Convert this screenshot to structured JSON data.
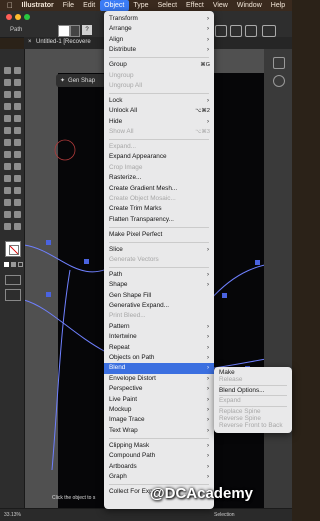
{
  "menubar": {
    "items": [
      "Illustrator",
      "File",
      "Edit",
      "Object",
      "Type",
      "Select",
      "Effect",
      "View",
      "Window",
      "Help"
    ],
    "active": "Object"
  },
  "control_bar": {
    "selection_label": "Path",
    "stroke_value": "?"
  },
  "document_tab": {
    "title": "Untitled-1 [Recovere"
  },
  "canvas_chip": {
    "label": "Gen Shap"
  },
  "status_bar": {
    "zoom": "33.13%",
    "hint": "Click the object to s",
    "mode": "Selection"
  },
  "object_menu": {
    "items": [
      {
        "label": "Transform",
        "submenu": true
      },
      {
        "label": "Arrange",
        "submenu": true
      },
      {
        "label": "Align",
        "submenu": true
      },
      {
        "label": "Distribute",
        "submenu": true
      },
      {
        "sep": true
      },
      {
        "label": "Group",
        "shortcut": "⌘G"
      },
      {
        "label": "Ungroup",
        "disabled": true
      },
      {
        "label": "Ungroup All",
        "disabled": true
      },
      {
        "sep": true
      },
      {
        "label": "Lock",
        "submenu": true
      },
      {
        "label": "Unlock All",
        "shortcut": "⌥⌘2"
      },
      {
        "label": "Hide",
        "submenu": true
      },
      {
        "label": "Show All",
        "shortcut": "⌥⌘3",
        "disabled": true
      },
      {
        "sep": true
      },
      {
        "label": "Expand...",
        "disabled": true
      },
      {
        "label": "Expand Appearance"
      },
      {
        "label": "Crop Image",
        "disabled": true
      },
      {
        "label": "Rasterize..."
      },
      {
        "label": "Create Gradient Mesh..."
      },
      {
        "label": "Create Object Mosaic...",
        "disabled": true
      },
      {
        "label": "Create Trim Marks"
      },
      {
        "label": "Flatten Transparency..."
      },
      {
        "sep": true
      },
      {
        "label": "Make Pixel Perfect"
      },
      {
        "sep": true
      },
      {
        "label": "Slice",
        "submenu": true
      },
      {
        "label": "Generate Vectors",
        "disabled": true
      },
      {
        "sep": true
      },
      {
        "label": "Path",
        "submenu": true
      },
      {
        "label": "Shape",
        "submenu": true
      },
      {
        "label": "Gen Shape Fill"
      },
      {
        "label": "Generative Expand..."
      },
      {
        "label": "Print Bleed...",
        "disabled": true
      },
      {
        "label": "Pattern",
        "submenu": true
      },
      {
        "label": "Intertwine",
        "submenu": true
      },
      {
        "label": "Repeat",
        "submenu": true
      },
      {
        "label": "Objects on Path",
        "submenu": true
      },
      {
        "label": "Blend",
        "submenu": true,
        "highlighted": true
      },
      {
        "label": "Envelope Distort",
        "submenu": true
      },
      {
        "label": "Perspective",
        "submenu": true
      },
      {
        "label": "Live Paint",
        "submenu": true
      },
      {
        "label": "Mockup",
        "submenu": true
      },
      {
        "label": "Image Trace",
        "submenu": true
      },
      {
        "label": "Text Wrap",
        "submenu": true
      },
      {
        "sep": true
      },
      {
        "label": "Clipping Mask",
        "submenu": true
      },
      {
        "label": "Compound Path",
        "submenu": true
      },
      {
        "label": "Artboards",
        "submenu": true
      },
      {
        "label": "Graph",
        "submenu": true
      },
      {
        "sep": true
      },
      {
        "label": "Collect For Export",
        "submenu": true
      }
    ]
  },
  "blend_menu": {
    "items": [
      {
        "label": "Make"
      },
      {
        "label": "Release",
        "disabled": true
      },
      {
        "sep": true
      },
      {
        "label": "Blend Options..."
      },
      {
        "sep": true
      },
      {
        "label": "Expand",
        "disabled": true
      },
      {
        "sep": true
      },
      {
        "label": "Replace Spine",
        "disabled": true
      },
      {
        "label": "Reverse Spine",
        "disabled": true
      },
      {
        "label": "Reverse Front to Back",
        "disabled": true
      }
    ]
  },
  "watermark": "@DCAcademy",
  "colors": {
    "accent": "#3b6fe0",
    "path_stroke": "#6f80ff",
    "anchor": "#4a63e0",
    "artboard": "#060608"
  }
}
